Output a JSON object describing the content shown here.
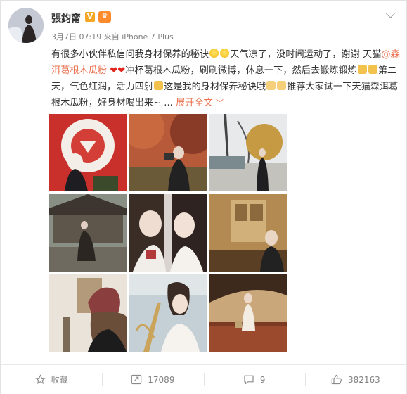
{
  "author": {
    "name": "張鈞甯",
    "verified_badge": "V"
  },
  "meta": {
    "time": "3月7日 07:19",
    "source": "来自 iPhone 7 Plus"
  },
  "post": {
    "seg1": "有很多小伙伴私信问我身材保养的秘诀",
    "seg2": "天气凉了，没时间运动了，谢谢 天猫",
    "mention": "@森洱葛根木瓜粉",
    "seg3": "冲杯葛根木瓜粉，刷刷微博，休息一下，然后去锻炼",
    "seg4": "锻炼",
    "seg5": "第二天，气色红润，活力四射",
    "seg6": "这是我的身材保养秘诀哦",
    "seg7": "推荐大家试一下天猫森洱葛根木瓜粉，好身材喝出来~ ...",
    "more": "展开全文",
    "more_icon": "chevron-down-icon"
  },
  "photos": [
    {
      "desc": "photo-1"
    },
    {
      "desc": "photo-2"
    },
    {
      "desc": "photo-3"
    },
    {
      "desc": "photo-4"
    },
    {
      "desc": "photo-5"
    },
    {
      "desc": "photo-6"
    },
    {
      "desc": "photo-7"
    },
    {
      "desc": "photo-8"
    },
    {
      "desc": "photo-9"
    }
  ],
  "actions": {
    "favorite": {
      "label": "收藏",
      "icon": "star-icon"
    },
    "repost": {
      "count": "17089",
      "icon": "repost-icon"
    },
    "comment": {
      "count": "9",
      "icon": "comment-icon"
    },
    "like": {
      "count": "382163",
      "icon": "thumbs-up-icon"
    }
  },
  "colors": {
    "accent": "#eb7350",
    "text": "#333333",
    "meta": "#808080"
  }
}
